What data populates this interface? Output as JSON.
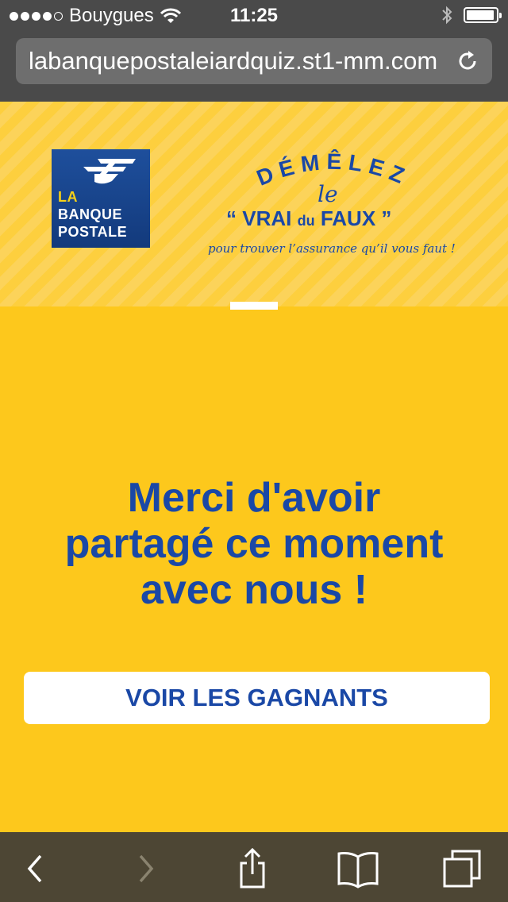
{
  "status_bar": {
    "carrier": "Bouygues",
    "time": "11:25",
    "signal_bars_filled": 4,
    "signal_bars_total": 5
  },
  "browser": {
    "url": "labanquepostaleiardquiz.st1-mm.com"
  },
  "header": {
    "logo": {
      "line1": "LA",
      "line2": "BANQUE",
      "line3": "POSTALE"
    },
    "tagline": {
      "word": "DÉMÊLEZ",
      "le": "le",
      "open_quote": "“",
      "vrai": "VRAI",
      "du": "du",
      "faux": "FAUX",
      "close_quote": "”",
      "subtitle": "pour trouver l’assurance qu’il vous faut !"
    }
  },
  "main": {
    "title_lines": [
      "Merci d'avoir",
      "partagé ce moment",
      "avec nous !"
    ],
    "cta_label": "VOIR LES GAGNANTS"
  },
  "toolbar": {
    "icons": [
      "back-icon",
      "forward-icon",
      "share-icon",
      "bookmarks-icon",
      "tabs-icon"
    ]
  },
  "colors": {
    "brand_blue": "#1a48a6",
    "yellow": "#fdc81c",
    "toolbar": "#4d4634",
    "browser_chrome": "#4a4a4a"
  }
}
